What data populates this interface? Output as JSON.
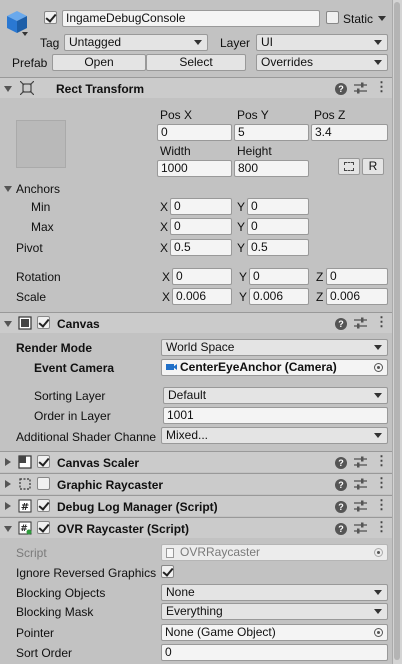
{
  "header": {
    "object_name": "IngameDebugConsole",
    "active": true,
    "static_label": "Static",
    "static_checked": false,
    "tag_label": "Tag",
    "tag_value": "Untagged",
    "layer_label": "Layer",
    "layer_value": "UI",
    "prefab_label": "Prefab",
    "open_label": "Open",
    "select_label": "Select",
    "overrides_label": "Overrides"
  },
  "rect_transform": {
    "title": "Rect Transform",
    "posx_label": "Pos X",
    "posy_label": "Pos Y",
    "posz_label": "Pos Z",
    "posx": "0",
    "posy": "5",
    "posz": "3.4",
    "width_label": "Width",
    "height_label": "Height",
    "width": "1000",
    "height": "800",
    "raw_label": "R",
    "anchors_label": "Anchors",
    "min_label": "Min",
    "max_label": "Max",
    "min_x": "0",
    "min_y": "0",
    "max_x": "0",
    "max_y": "0",
    "pivot_label": "Pivot",
    "pivot_x": "0.5",
    "pivot_y": "0.5",
    "rotation_label": "Rotation",
    "rot_x": "0",
    "rot_y": "0",
    "rot_z": "0",
    "scale_label": "Scale",
    "scale_x": "0.006",
    "scale_y": "0.006",
    "scale_z": "0.006",
    "x": "X",
    "y": "Y",
    "z": "Z"
  },
  "canvas": {
    "title": "Canvas",
    "render_mode_label": "Render Mode",
    "render_mode": "World Space",
    "event_camera_label": "Event Camera",
    "event_camera": "CenterEyeAnchor (Camera)",
    "sorting_layer_label": "Sorting Layer",
    "sorting_layer": "Default",
    "order_label": "Order in Layer",
    "order": "1001",
    "shader_label": "Additional Shader Channe",
    "shader": "Mixed..."
  },
  "components": {
    "canvas_scaler": "Canvas Scaler",
    "graphic_raycaster": "Graphic Raycaster",
    "debug_log_manager": "Debug Log Manager (Script)",
    "ovr_raycaster": "OVR Raycaster (Script)"
  },
  "ovr": {
    "script_label": "Script",
    "script": "OVRRaycaster",
    "ignore_label": "Ignore Reversed Graphics",
    "blocking_objects_label": "Blocking Objects",
    "blocking_objects": "None",
    "blocking_mask_label": "Blocking Mask",
    "blocking_mask": "Everything",
    "pointer_label": "Pointer",
    "pointer": "None (Game Object)",
    "sort_order_label": "Sort Order",
    "sort_order": "0"
  },
  "icons": {
    "header_menu": "ellipsis-vertical-icon",
    "help": "?",
    "presets": "sliders-icon"
  },
  "colors": {
    "background": "#c2c2c2",
    "component_header": "#cbcbcb",
    "camera_icon": "#1f6fc8",
    "cube_icon": "#2a78d2"
  }
}
